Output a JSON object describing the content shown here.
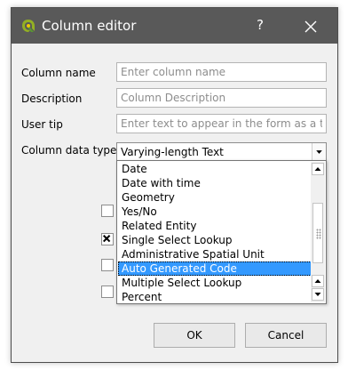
{
  "window": {
    "title": "Column editor",
    "help_label": "?"
  },
  "form": {
    "column_name": {
      "label": "Column name",
      "placeholder": "Enter column name",
      "value": ""
    },
    "description": {
      "label": "Description",
      "placeholder": "Column Description",
      "value": ""
    },
    "user_tip": {
      "label": "User tip",
      "placeholder": "Enter text to appear in the form as a t...",
      "value": ""
    },
    "data_type": {
      "label": "Column data type",
      "selected": "Varying-length Text"
    }
  },
  "data_type_options": [
    "Date",
    "Date with time",
    "Geometry",
    "Yes/No",
    "Related Entity",
    "Single Select Lookup",
    "Administrative Spatial Unit",
    "Auto Generated Code",
    "Multiple Select Lookup",
    "Percent"
  ],
  "highlighted_option": "Auto Generated Code",
  "checkboxes": [
    {
      "checked": false
    },
    {
      "checked": true
    },
    {
      "checked": false
    },
    {
      "checked": false
    }
  ],
  "buttons": {
    "ok": "OK",
    "cancel": "Cancel"
  },
  "colors": {
    "titlebar": "#595959",
    "selection": "#3399ff",
    "dialog_bg": "#f0f0f0"
  }
}
